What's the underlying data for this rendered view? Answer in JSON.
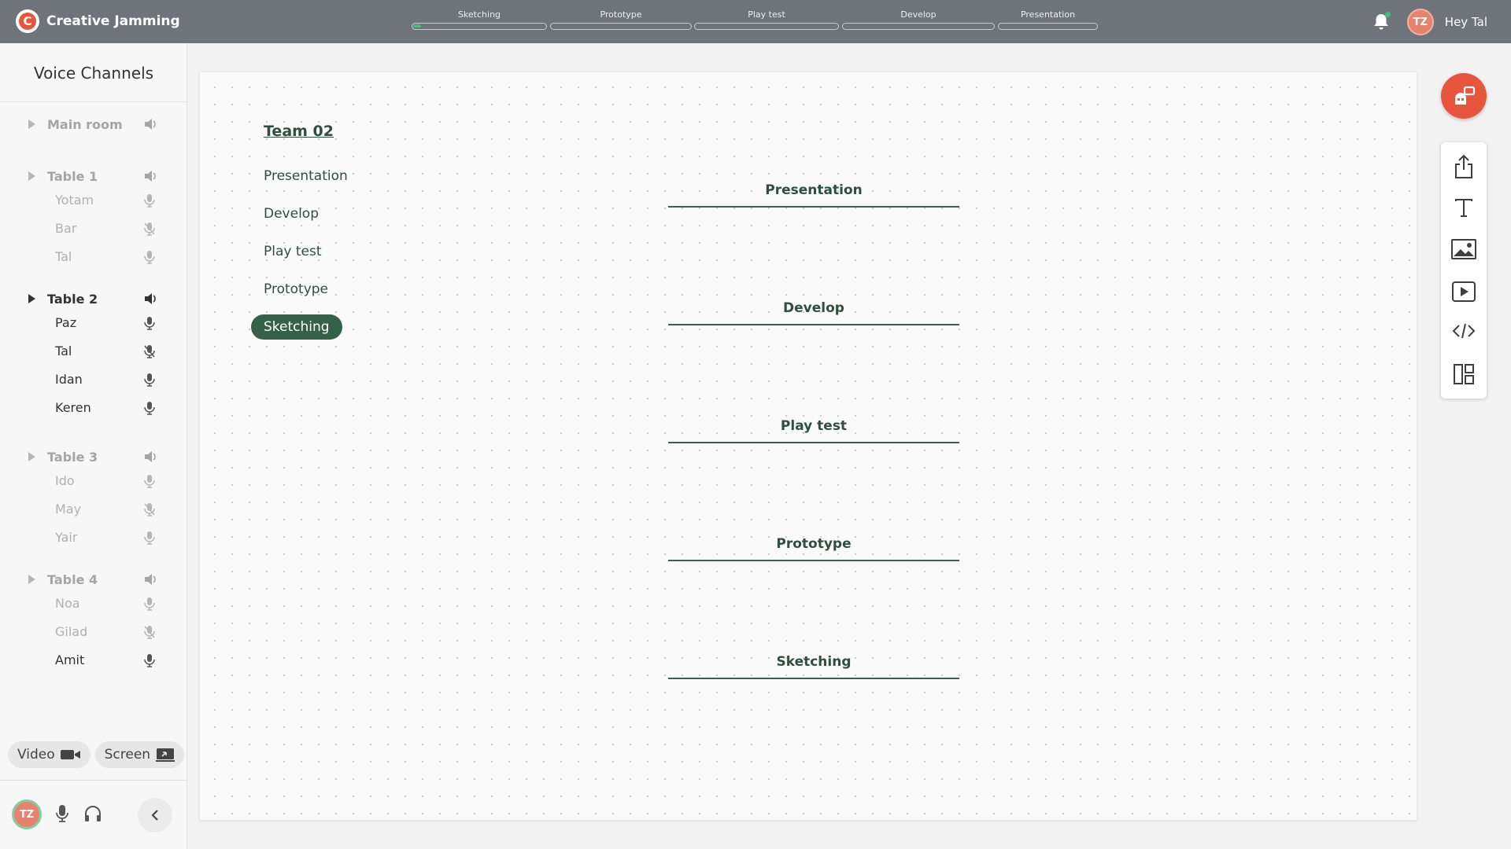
{
  "app": {
    "name": "Creative Jamming",
    "logo_letter": "C"
  },
  "stages_progress": {
    "steps": [
      {
        "label": "Sketching",
        "progress": 0.06
      },
      {
        "label": "Prototype",
        "progress": 0
      },
      {
        "label": "Play test",
        "progress": 0
      },
      {
        "label": "Develop",
        "progress": 0
      },
      {
        "label": "Presentation",
        "progress": 0
      }
    ]
  },
  "user": {
    "initials": "TZ",
    "greeting": "Hey Tal"
  },
  "sidebar": {
    "title": "Voice Channels",
    "rooms": [
      {
        "name": "Main room",
        "active": false,
        "members": []
      },
      {
        "name": "Table 1",
        "active": false,
        "members": [
          {
            "name": "Yotam",
            "muted": false,
            "active": false
          },
          {
            "name": "Bar",
            "muted": true,
            "active": false
          },
          {
            "name": "Tal",
            "muted": false,
            "active": false
          }
        ]
      },
      {
        "name": "Table 2",
        "active": true,
        "members": [
          {
            "name": "Paz",
            "muted": false,
            "active": true
          },
          {
            "name": "Tal",
            "muted": true,
            "active": true
          },
          {
            "name": "Idan",
            "muted": false,
            "active": true
          },
          {
            "name": "Keren",
            "muted": false,
            "active": true
          }
        ]
      },
      {
        "name": "Table 3",
        "active": false,
        "members": [
          {
            "name": "Ido",
            "muted": false,
            "active": false
          },
          {
            "name": "May",
            "muted": true,
            "active": false
          },
          {
            "name": "Yair",
            "muted": false,
            "active": false
          }
        ]
      },
      {
        "name": "Table 4",
        "active": false,
        "members": [
          {
            "name": "Noa",
            "muted": false,
            "active": false
          },
          {
            "name": "Gilad",
            "muted": true,
            "active": false
          },
          {
            "name": "Amit",
            "muted": false,
            "active": true
          }
        ]
      }
    ],
    "video_label": "Video",
    "screen_label": "Screen"
  },
  "board": {
    "team_title": "Team 02",
    "stage_links": [
      "Presentation",
      "Develop",
      "Play test",
      "Prototype",
      "Sketching"
    ],
    "selected_stage": "Sketching",
    "sections": [
      "Presentation",
      "Develop",
      "Play test",
      "Prototype",
      "Sketching"
    ]
  },
  "tools": [
    "share-icon",
    "text-icon",
    "image-icon",
    "video-icon",
    "code-icon",
    "layout-icon"
  ],
  "colors": {
    "accent": "#e8553d",
    "green_dark": "#356247",
    "progress": "#3fbf7f",
    "topbar": "#6f737a"
  }
}
